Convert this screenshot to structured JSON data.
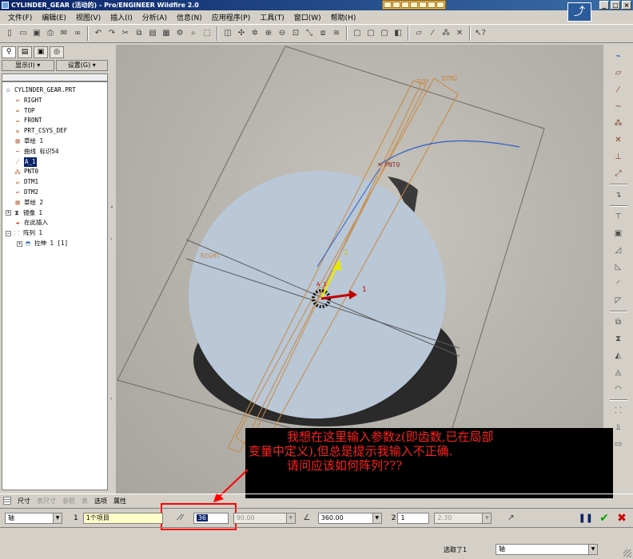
{
  "window": {
    "title": "CYLINDER_GEAR (活动的) - Pro/ENGINEER Wildfire 2.0",
    "controls": [
      "_",
      "□",
      "×"
    ]
  },
  "menu": [
    "文件(F)",
    "编辑(E)",
    "视图(V)",
    "插入(I)",
    "分析(A)",
    "信息(N)",
    "应用程序(P)",
    "工具(T)",
    "窗口(W)",
    "帮助(H)"
  ],
  "left_panel": {
    "display_label": "显示(I) ▾",
    "settings_label": "设置(G) ▾",
    "tree": [
      {
        "label": "CYLINDER_GEAR.PRT",
        "icon": "part-icon"
      },
      {
        "label": "RIGHT",
        "icon": "datum-plane-icon"
      },
      {
        "label": "TOP",
        "icon": "datum-plane-icon"
      },
      {
        "label": "FRONT",
        "icon": "datum-plane-icon"
      },
      {
        "label": "PRT_CSYS_DEF",
        "icon": "csys-icon"
      },
      {
        "label": "草绘 1",
        "icon": "sketch-icon"
      },
      {
        "label": "曲线 标识54",
        "icon": "curve-icon"
      },
      {
        "label": "A_1",
        "icon": "axis-icon"
      },
      {
        "label": "PNT0",
        "icon": "datum-point-icon"
      },
      {
        "label": "DTM1",
        "icon": "datum-plane-icon"
      },
      {
        "label": "DTM2",
        "icon": "datum-plane-icon"
      },
      {
        "label": "草绘 2",
        "icon": "sketch-icon"
      },
      {
        "label": "镜像 1",
        "icon": "mirror-icon"
      },
      {
        "label": "在此插入",
        "icon": "insert-here-icon"
      },
      {
        "label": "阵列 1",
        "icon": "pattern-icon"
      },
      {
        "label": "拉伸 1 [1]",
        "icon": "extrude-icon"
      }
    ]
  },
  "viewport": {
    "labels": {
      "top": "TOP",
      "dtm2": "DTM2",
      "pnt0": "PNT0",
      "right": "RIGHT",
      "axis": "A_1",
      "dir1": "1",
      "dir2": "2"
    }
  },
  "annotation": {
    "line1": "我想在这里输入参数z(即齿数,已在局部",
    "line2": "变量中定义),但总是提示我输入不正确.",
    "line3": "请问应该如何阵列???"
  },
  "dashboard": {
    "tabs": [
      "尺寸",
      "表尺寸",
      "参照",
      "表",
      "选项",
      "属性"
    ],
    "type": "轴",
    "dir1_num": "1",
    "dir1_items": "1个项目",
    "count_value": "36",
    "spacing_value": "90.00",
    "angle_value": "360.00",
    "dir2_num": "2",
    "dir2_count": "1",
    "dir2_spacing": "2.30"
  },
  "status": {
    "selected": "选取了1",
    "filter": "轴"
  },
  "colors": {
    "annotation_text": "#ff2020",
    "red_box": "#ff0000",
    "datum_orange": "#c88a40",
    "gear_face": "#b9c7d6"
  }
}
